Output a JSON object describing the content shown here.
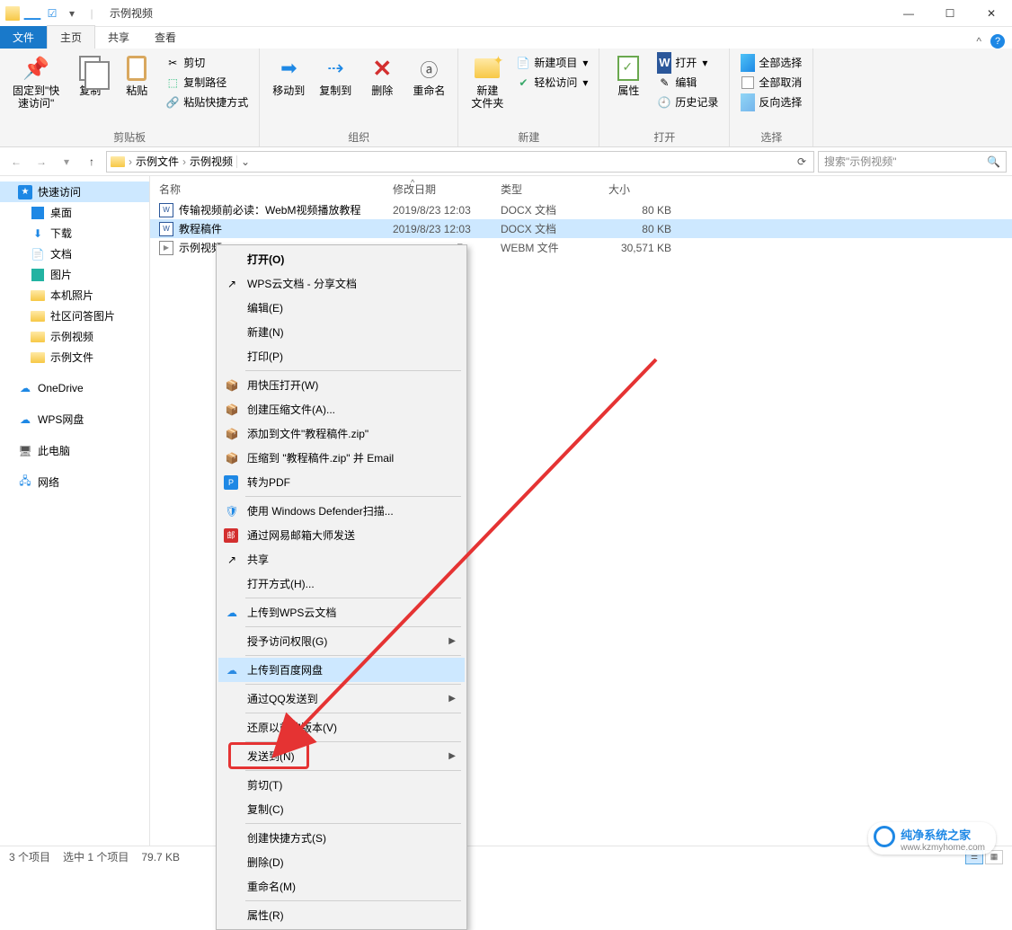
{
  "window": {
    "title": "示例视频"
  },
  "tabs": {
    "file": "文件",
    "home": "主页",
    "share": "共享",
    "view": "查看"
  },
  "ribbon": {
    "clipboard": {
      "label": "剪贴板",
      "pin": "固定到\"快\n速访问\"",
      "copy": "复制",
      "paste": "粘贴",
      "cut": "剪切",
      "copypath": "复制路径",
      "pasteshortcut": "粘贴快捷方式"
    },
    "organize": {
      "label": "组织",
      "moveto": "移动到",
      "copyto": "复制到",
      "delete": "删除",
      "rename": "重命名"
    },
    "new": {
      "label": "新建",
      "newfolder": "新建\n文件夹",
      "newitem": "新建项目",
      "easyaccess": "轻松访问"
    },
    "open": {
      "label": "打开",
      "properties": "属性",
      "open": "打开",
      "edit": "编辑",
      "history": "历史记录"
    },
    "select": {
      "label": "选择",
      "all": "全部选择",
      "none": "全部取消",
      "invert": "反向选择"
    }
  },
  "address": {
    "seg1": "示例文件",
    "seg2": "示例视频",
    "search_placeholder": "搜索\"示例视频\""
  },
  "nav": {
    "quick": "快速访问",
    "desktop": "桌面",
    "downloads": "下载",
    "documents": "文档",
    "pictures": "图片",
    "localphotos": "本机照片",
    "qaphotos": "社区问答图片",
    "samplevideos": "示例视频",
    "samplefiles": "示例文件",
    "onedrive": "OneDrive",
    "wps": "WPS网盘",
    "thispc": "此电脑",
    "network": "网络"
  },
  "cols": {
    "name": "名称",
    "modified": "修改日期",
    "type": "类型",
    "size": "大小"
  },
  "rows": [
    {
      "name": "传输视频前必读：WebM视频播放教程",
      "date": "2019/8/23 12:03",
      "type": "DOCX 文档",
      "size": "80 KB"
    },
    {
      "name": "教程稿件",
      "date": "2019/8/23 12:03",
      "type": "DOCX 文档",
      "size": "80 KB"
    },
    {
      "name": "示例视频",
      "date": "",
      "type": "WEBM 文件",
      "size": "30,571 KB"
    }
  ],
  "row3_date_partial": "7",
  "status": {
    "items": "3 个项目",
    "selected": "选中 1 个项目",
    "selsize": "79.7 KB"
  },
  "ctx": {
    "open": "打开(O)",
    "wpsshare": "WPS云文档 - 分享文档",
    "edit": "编辑(E)",
    "new": "新建(N)",
    "print": "打印(P)",
    "kuaizip": "用快压打开(W)",
    "createzip": "创建压缩文件(A)...",
    "addtozip": "添加到文件\"教程稿件.zip\"",
    "zipemail": "压缩到 \"教程稿件.zip\" 并 Email",
    "topdf": "转为PDF",
    "defender": "使用 Windows Defender扫描...",
    "wangyi": "通过网易邮箱大师发送",
    "share": "共享",
    "openwith": "打开方式(H)...",
    "uploadwps": "上传到WPS云文档",
    "grantaccess": "授予访问权限(G)",
    "uploadbaidu": "上传到百度网盘",
    "sendqq": "通过QQ发送到",
    "restore": "还原以前的版本(V)",
    "sendto": "发送到(N)",
    "cut": "剪切(T)",
    "copy": "复制(C)",
    "shortcut": "创建快捷方式(S)",
    "delete": "删除(D)",
    "rename": "重命名(M)",
    "props": "属性(R)"
  },
  "watermark": {
    "t1": "纯净系统之家",
    "t2": "www.kzmyhome.com"
  }
}
